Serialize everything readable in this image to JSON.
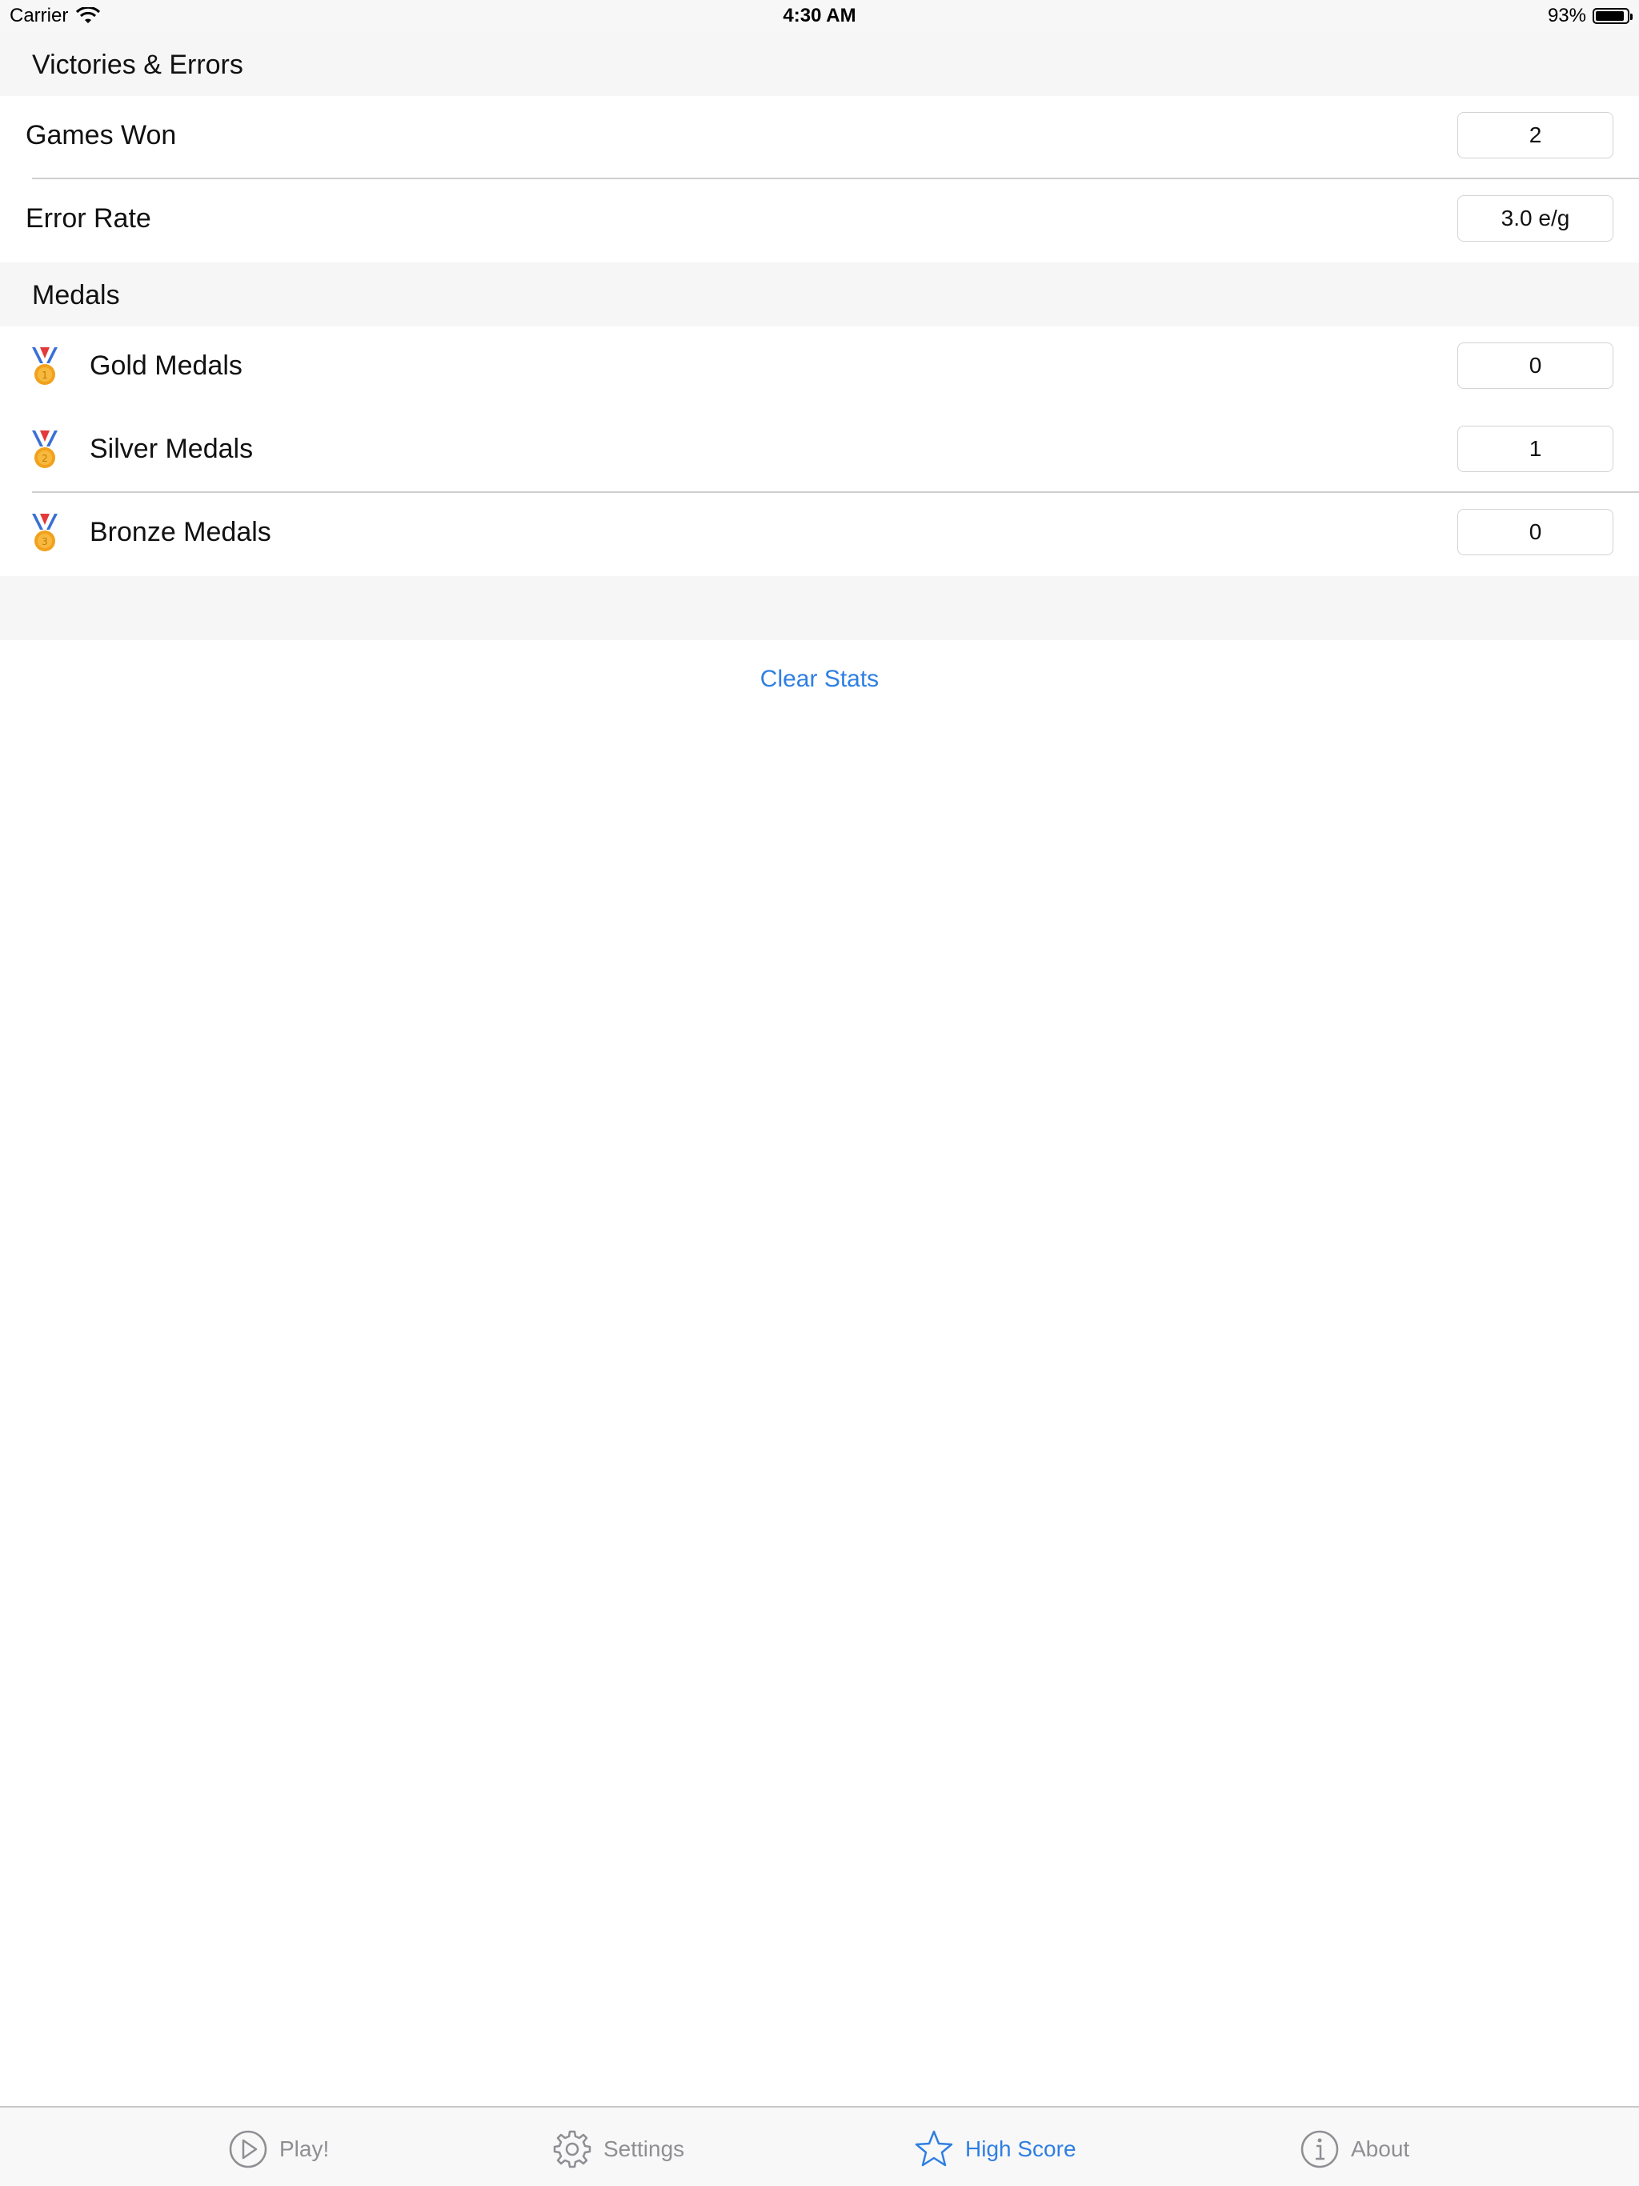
{
  "status_bar": {
    "carrier": "Carrier",
    "time": "4:30 AM",
    "battery_percent": "93%",
    "battery_level": 0.93
  },
  "sections": {
    "victories": {
      "title": "Victories & Errors",
      "rows": [
        {
          "label": "Games Won",
          "value": "2"
        },
        {
          "label": "Error Rate",
          "value": "3.0 e/g"
        }
      ]
    },
    "medals": {
      "title": "Medals",
      "rows": [
        {
          "label": "Gold Medals",
          "value": "0",
          "icon": "gold-medal-icon",
          "number": "1"
        },
        {
          "label": "Silver Medals",
          "value": "1",
          "icon": "silver-medal-icon",
          "number": "2"
        },
        {
          "label": "Bronze Medals",
          "value": "0",
          "icon": "bronze-medal-icon",
          "number": "3"
        }
      ]
    }
  },
  "actions": {
    "clear_stats": "Clear Stats"
  },
  "tab_bar": {
    "items": [
      {
        "label": "Play!",
        "icon": "play-icon",
        "active": false
      },
      {
        "label": "Settings",
        "icon": "gear-icon",
        "active": false
      },
      {
        "label": "High Score",
        "icon": "star-icon",
        "active": true
      },
      {
        "label": "About",
        "icon": "info-icon",
        "active": false
      }
    ]
  },
  "colors": {
    "accent": "#2f7fe2",
    "inactive_tab": "#8e8e93",
    "section_background": "#f6f6f6",
    "medal_gold": "#f2a11c"
  }
}
